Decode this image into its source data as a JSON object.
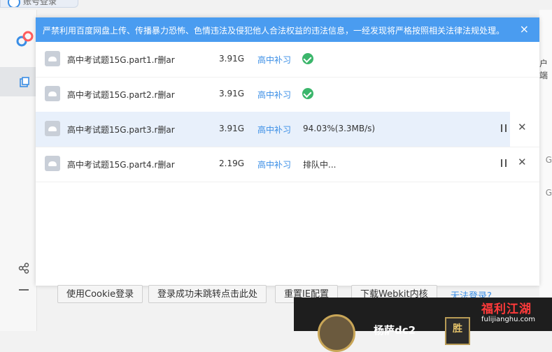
{
  "background": {
    "tab_title": "账号登录",
    "right_texts": [
      "户端",
      "G",
      "G"
    ]
  },
  "notice": {
    "message": "严禁利用百度网盘上传、传播暴力恐怖、色情违法及侵犯他人合法权益的违法信息，一经发现将严格按照相关法律法规处理。",
    "close_glyph": "×"
  },
  "downloads": [
    {
      "name": "高中考试题15G.part1.r删ar",
      "size": "3.91G",
      "folder": "高中补习",
      "status": "done"
    },
    {
      "name": "高中考试题15G.part2.r删ar",
      "size": "3.91G",
      "folder": "高中补习",
      "status": "done"
    },
    {
      "name": "高中考试题15G.part3.r删ar",
      "size": "3.91G",
      "folder": "高中补习",
      "status": "94.03%(3.3MB/s)"
    },
    {
      "name": "高中考试题15G.part4.r删ar",
      "size": "2.19G",
      "folder": "高中补习",
      "status": "排队中..."
    }
  ],
  "buttons": {
    "cookie_login": "使用Cookie登录",
    "click_here": "登录成功未跳转点击此处",
    "reset_ie": "重置IE配置",
    "download_webkit": "下载Webkit内核",
    "cannot_login": "无法登录?"
  },
  "overlay": {
    "username": "杨萨dc2",
    "badge": "胜",
    "watermark_big": "福利江湖",
    "watermark_small": "fulijianghu.com"
  },
  "colors": {
    "accent": "#4a9cf0",
    "link": "#3a8ee6",
    "success": "#3bb66b",
    "active_row": "#e8f0fb"
  }
}
